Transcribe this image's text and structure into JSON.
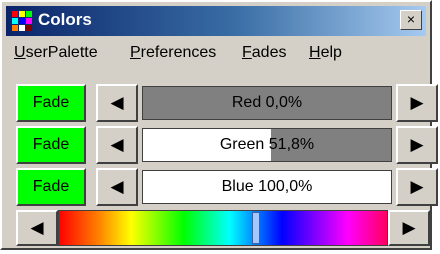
{
  "window": {
    "title": "Colors",
    "close_label": "×"
  },
  "menu": [
    {
      "label": "UserPalette",
      "mnemonic": "U",
      "rest": "serPalette"
    },
    {
      "label": "Preferences",
      "mnemonic": "P",
      "rest": "references"
    },
    {
      "label": "Fades",
      "mnemonic": "F",
      "rest": "ades"
    },
    {
      "label": "Help",
      "mnemonic": "H",
      "rest": "elp"
    }
  ],
  "channels": [
    {
      "fade_label": "Fade",
      "left_arrow": "◀",
      "right_arrow": "▶",
      "label": "Red 0,0%",
      "fraction": 0.0
    },
    {
      "fade_label": "Fade",
      "left_arrow": "◀",
      "right_arrow": "▶",
      "label": "Green 51,8%",
      "fraction": 0.518
    },
    {
      "fade_label": "Fade",
      "left_arrow": "◀",
      "right_arrow": "▶",
      "label": "Blue 100,0%",
      "fraction": 1.0
    }
  ],
  "spectrum": {
    "left_arrow": "◀",
    "right_arrow": "▶",
    "position": 0.6
  },
  "colors": {
    "fade_button": "#00ff00",
    "face": "#d4d0c8",
    "track_empty": "#808080",
    "track_fill": "#ffffff"
  },
  "icons": [
    "app-palette-icon",
    "close-icon",
    "left-arrow-icon",
    "right-arrow-icon"
  ]
}
